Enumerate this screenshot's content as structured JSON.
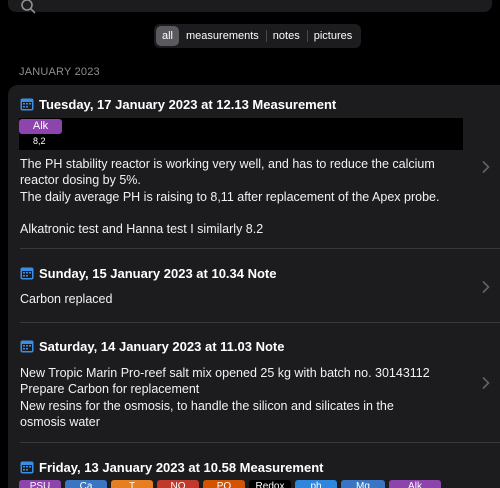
{
  "filters": {
    "options": [
      "all",
      "measurements",
      "notes",
      "pictures"
    ],
    "selected": "all"
  },
  "section": {
    "header": "JANUARY 2023"
  },
  "entries": [
    {
      "title": "Tuesday, 17 January 2023 at 12.13 Measurement",
      "tag": {
        "label": "Alk",
        "value": "8,2",
        "color": "#8e44ad"
      },
      "lines": [
        "The PH stability reactor is working very well, and has to reduce the calcium",
        "reactor dosing by 5%.",
        "The daily average PH  is raising to 8,11 after replacement of the Apex probe.",
        "",
        "Alkatronic test and Hanna test I similarly 8.2"
      ]
    },
    {
      "title": "Sunday, 15 January 2023 at 10.34 Note",
      "lines": [
        "Carbon replaced"
      ]
    },
    {
      "title": "Saturday, 14 January 2023 at 11.03 Note",
      "lines": [
        "New Tropic Marin Pro-reef salt mix opened 25 kg with batch no. 30143112",
        "Prepare Carbon for replacement",
        "New resins for the osmosis, to handle the silicon and silicates in the",
        "osmosis water"
      ]
    },
    {
      "title": "Friday, 13 January 2023 at 10.58 Measurement",
      "tags": [
        {
          "label": "PSU",
          "color": "#8e44ad"
        },
        {
          "label": "Ca",
          "color": "#3a75c4"
        },
        {
          "label": "T",
          "color": "#e67e22"
        },
        {
          "label": "NO",
          "color": "#c0392b"
        },
        {
          "label": "PO",
          "color": "#d35400"
        },
        {
          "label": "Redox",
          "color": "#000000"
        },
        {
          "label": "ph",
          "color": "#2e86de"
        },
        {
          "label": "Mg",
          "color": "#3a75c4"
        },
        {
          "label": "Alk",
          "color": "#8e44ad"
        }
      ]
    }
  ],
  "icons": {
    "calendar": "calendar-icon",
    "search": "search-icon",
    "chevron": "chevron-right-icon"
  },
  "colors": {
    "accent": "#3a8ee6",
    "background": "#000000",
    "card": "#1c1c1e"
  }
}
